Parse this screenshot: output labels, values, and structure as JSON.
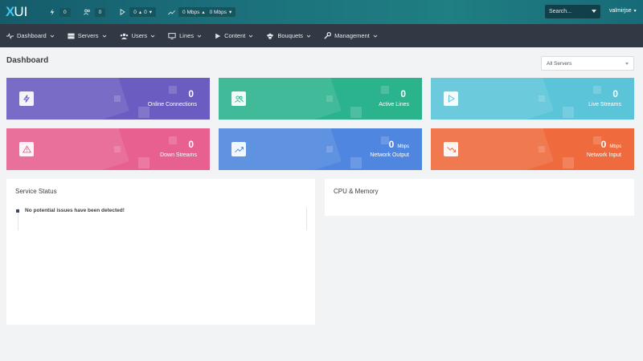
{
  "brand": {
    "logo_x": "X",
    "logo_ui": "UI"
  },
  "topbar": {
    "connections_count": "0",
    "users_count": "0",
    "streams_up": "0",
    "streams_down": "0",
    "bandwidth_out": "0 Mbps",
    "bandwidth_in": "0 Mbps",
    "search_placeholder": "Search...",
    "username": "valmirjse"
  },
  "nav": {
    "items": [
      {
        "label": "Dashboard",
        "icon": "pulse-icon"
      },
      {
        "label": "Servers",
        "icon": "server-icon"
      },
      {
        "label": "Users",
        "icon": "users-icon"
      },
      {
        "label": "Lines",
        "icon": "monitor-icon"
      },
      {
        "label": "Content",
        "icon": "play-icon"
      },
      {
        "label": "Bouquets",
        "icon": "bouquet-icon"
      },
      {
        "label": "Management",
        "icon": "wrench-icon"
      }
    ]
  },
  "page": {
    "title": "Dashboard",
    "server_select": "All Servers"
  },
  "cards": [
    {
      "value": "0",
      "unit": "",
      "label": "Online Connections",
      "color": "#6a5cc0",
      "icon": "bolt-icon"
    },
    {
      "value": "0",
      "unit": "",
      "label": "Active Lines",
      "color": "#2bb38e",
      "icon": "users-icon"
    },
    {
      "value": "0",
      "unit": "",
      "label": "Live Streams",
      "color": "#5bc4d9",
      "icon": "play-icon"
    },
    {
      "value": "0",
      "unit": "",
      "label": "Down Streams",
      "color": "#e7608f",
      "icon": "alert-icon"
    },
    {
      "value": "0",
      "unit": "Mbps",
      "label": "Network Output",
      "color": "#4f86df",
      "icon": "trending-up-icon"
    },
    {
      "value": "0",
      "unit": "Mbps",
      "label": "Network Input",
      "color": "#ef6a3c",
      "icon": "trending-down-icon"
    }
  ],
  "service_status": {
    "title": "Service Status",
    "message": "No potential issues have been detected!"
  },
  "cpu_memory": {
    "title": "CPU & Memory"
  }
}
